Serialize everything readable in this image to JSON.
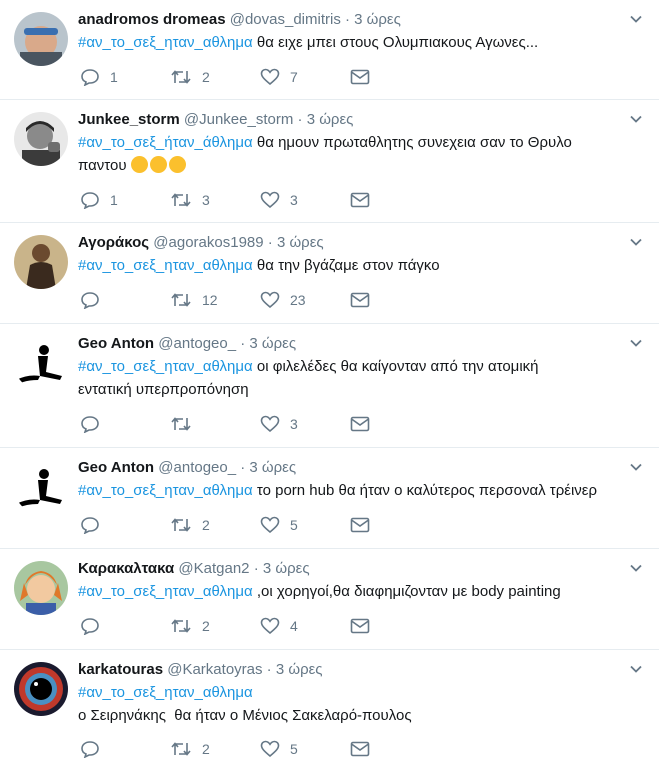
{
  "time_label": "3 ώρες",
  "dot": "·",
  "tweets": [
    {
      "name": "anadromos dromeas",
      "handle": "@dovas_dimitris",
      "hashtag": "#αν_το_σεξ_ηταν_αθλημα",
      "text": " θα ειχε μπει στους Ολυμπιακους Αγωνες...",
      "line2": "",
      "replies": "1",
      "retweets": "2",
      "likes": "7"
    },
    {
      "name": "Junkee_storm",
      "handle": "@Junkee_storm",
      "hashtag": "#αν_το_σεξ_ήταν_άθλημα",
      "text": " θα ημουν πρωταθλητης συνεχεια σαν το Θρυλο",
      "line2": "παντου",
      "replies": "1",
      "retweets": "3",
      "likes": "3"
    },
    {
      "name": "Αγοράκος",
      "handle": "@agorakos1989",
      "hashtag": "#αν_το_σεξ_ηταν_αθλημα",
      "text": " θα την βγάζαμε στον πάγκο",
      "line2": "",
      "replies": "",
      "retweets": "12",
      "likes": "23"
    },
    {
      "name": "Geo Anton",
      "handle": "@antogeo_",
      "hashtag": "#αν_το_σεξ_ηταν_αθλημα",
      "text": " οι φιλελέδες θα καίγονταν από την ατομική",
      "line2": "εντατική υπερπροπόνηση",
      "replies": "",
      "retweets": "",
      "likes": "3"
    },
    {
      "name": "Geo Anton",
      "handle": "@antogeo_",
      "hashtag": "#αν_το_σεξ_ηταν_αθλημα",
      "text": " το porn hub θα ήταν ο καλύτερος περσοναλ τρέινερ",
      "line2": "",
      "replies": "",
      "retweets": "2",
      "likes": "5"
    },
    {
      "name": "Καρακαλτακα",
      "handle": "@Katgan2",
      "hashtag": "#αν_το_σεξ_ηταν_αθλημα",
      "text": " ,οι χορηγοί,θα διαφημιζονταν με body painting",
      "line2": "",
      "replies": "",
      "retweets": "2",
      "likes": "4"
    },
    {
      "name": "karkatouras",
      "handle": "@Karkatoyras",
      "hashtag": "#αν_το_σεξ_ηταν_αθλημα",
      "text": "",
      "line2": "ο Σειρηνάκης  θα ήταν ο Μένιος Σακελαρό-πουλος",
      "replies": "",
      "retweets": "2",
      "likes": "5"
    }
  ]
}
